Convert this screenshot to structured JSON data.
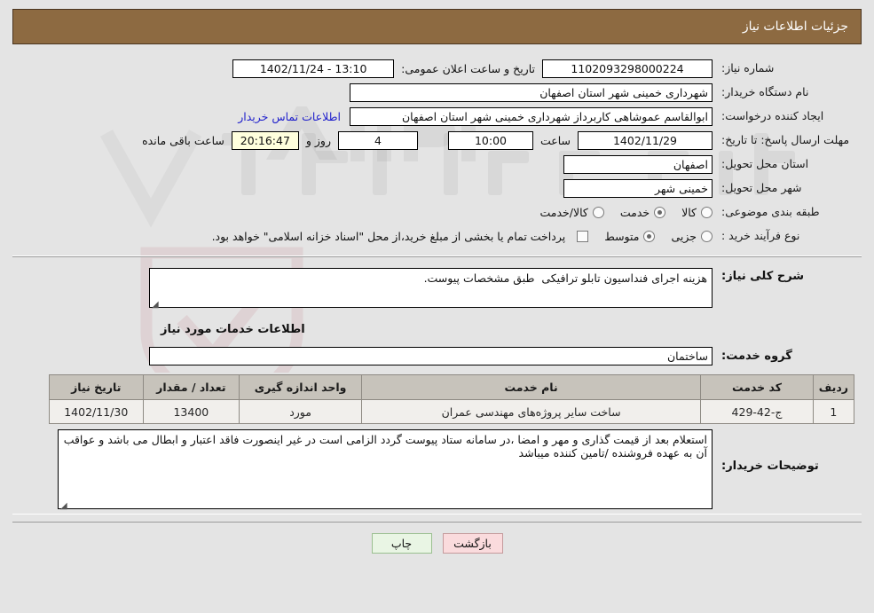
{
  "header": {
    "title": "جزئیات اطلاعات نیاز"
  },
  "form": {
    "need_number_label": "شماره نیاز:",
    "need_number_value": "1102093298000224",
    "public_announce_label": "تاریخ و ساعت اعلان عمومی:",
    "public_announce_value": "13:10 - 1402/11/24",
    "buyer_org_label": "نام دستگاه خریدار:",
    "buyer_org_value": "شهرداری خمینی شهر استان اصفهان",
    "requester_label": "ایجاد کننده درخواست:",
    "requester_value": "ابوالقاسم عموشاهی کاربرداز شهرداری خمینی شهر استان اصفهان",
    "contact_link": "اطلاعات تماس خریدار",
    "deadline_label": "مهلت ارسال پاسخ: تا تاریخ:",
    "deadline_date": "1402/11/29",
    "hour_label": "ساعت",
    "hour_value": "10:00",
    "days_value": "4",
    "days_label": "روز و",
    "timer_value": "20:16:47",
    "remaining_label": "ساعت باقی مانده",
    "province_label": "استان محل تحویل:",
    "province_value": "اصفهان",
    "city_label": "شهر محل تحویل:",
    "city_value": "خمینی شهر",
    "category_label": "طبقه بندی موضوعی:",
    "category_options": [
      {
        "label": "کالا",
        "selected": false
      },
      {
        "label": "خدمت",
        "selected": true
      },
      {
        "label": "کالا/خدمت",
        "selected": false
      }
    ],
    "process_label": "نوع فرآیند خرید :",
    "process_options": [
      {
        "label": "جزیی",
        "selected": false
      },
      {
        "label": "متوسط",
        "selected": true
      }
    ],
    "treasury_checkbox_checked": false,
    "treasury_note": "پرداخت تمام یا بخشی از مبلغ خرید،از محل \"اسناد خزانه اسلامی\" خواهد بود."
  },
  "middle": {
    "general_desc_label": "شرح کلی نیاز:",
    "general_desc_value": "هزینه اجرای فنداسیون تابلو ترافیکی  طبق مشخصات پیوست.",
    "services_section_title": "اطلاعات خدمات مورد نیاز",
    "service_group_label": "گروه خدمت:",
    "service_group_value": "ساختمان"
  },
  "table": {
    "headers": [
      "ردیف",
      "کد خدمت",
      "نام خدمت",
      "واحد اندازه گیری",
      "تعداد / مقدار",
      "تاریخ نیاز"
    ],
    "rows": [
      {
        "index": "1",
        "code": "ج-42-429",
        "name": "ساخت سایر پروژه‌های مهندسی عمران",
        "unit": "مورد",
        "quantity": "13400",
        "need_date": "1402/11/30"
      }
    ]
  },
  "notes": {
    "buyer_notes_label": "توضیحات خریدار:",
    "buyer_notes_value": "استعلام بعد از قیمت گذاری و مهر و امضا ،در سامانه ستاد پیوست گردد الزامی است در غیر اینصورت فاقد اعتبار و ابطال می باشد و عواقب آن به عهده فروشنده /تامین کننده میباشد"
  },
  "footer": {
    "back_label": "بازگشت",
    "print_label": "چاپ"
  },
  "watermark": {
    "text": "AriaTender.net"
  },
  "colors": {
    "header_bg": "#8d6a41",
    "timer_bg": "#ffffdd",
    "link": "#2222cc",
    "table_header_bg": "#c7c3bb",
    "table_row_bg": "#f1efec",
    "back_btn_bg": "#fadbdd",
    "print_btn_bg": "#e9f5e4",
    "page_bg": "#e4e4e4"
  }
}
